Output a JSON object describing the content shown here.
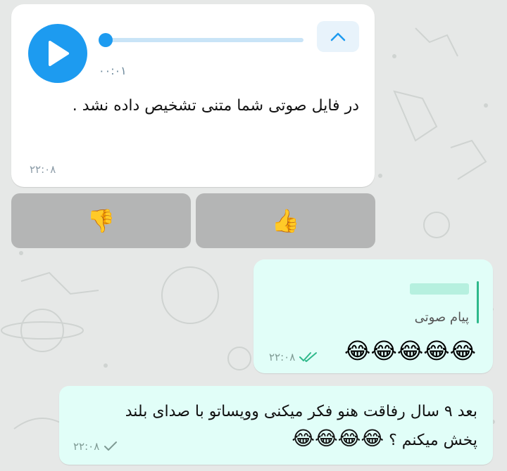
{
  "incoming": {
    "duration": "۰۰:۰۱",
    "message": "در فایل صوتی شما متنی تشخیص داده نشد .",
    "time": "۲۲:۰۸"
  },
  "reactions": {
    "dislike": "👎",
    "like": "👍"
  },
  "outgoing1": {
    "reply_label": "پیام صوتی",
    "emojis": "😂😂😂😂😂",
    "time": "۲۲:۰۸",
    "status": "read"
  },
  "outgoing2": {
    "line1": "بعد ۹ سال رفاقت هنو فکر میکنی وویساتو با صدای بلند",
    "line2": "پخش میکنم ؟",
    "emojis": "😂😂😂😂",
    "time": "۲۲:۰۸",
    "status": "sent"
  },
  "colors": {
    "accent": "#1d9bf0",
    "outgoing_bubble": "#e1fef8",
    "incoming_bubble": "#ffffff",
    "check": "#2fb98b"
  }
}
